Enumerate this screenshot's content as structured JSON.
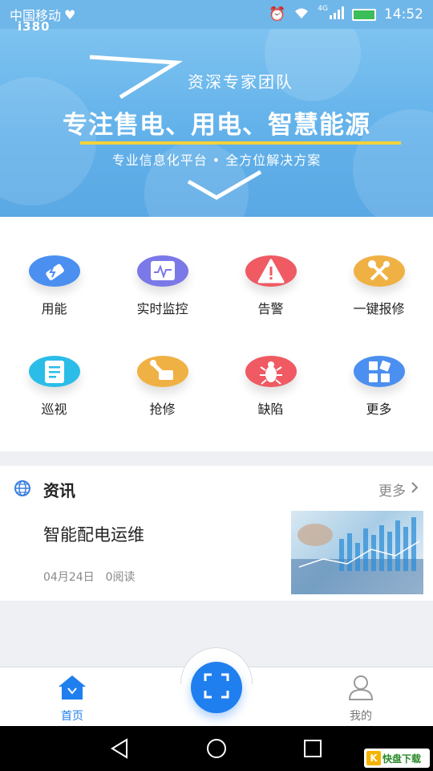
{
  "status_bar": {
    "carrier": "中国移动",
    "time": "14:52",
    "network": "4G",
    "logo": "i380"
  },
  "banner": {
    "subtitle1": "资深专家团队",
    "title": "专注售电、用电、智慧能源",
    "subtitle2": "专业信息化平台  •  全方位解决方案"
  },
  "grid": [
    {
      "label": "用能",
      "icon": "energy-icon",
      "color": "#4b8ff0"
    },
    {
      "label": "实时监控",
      "icon": "monitor-icon",
      "color": "#7b78e8"
    },
    {
      "label": "告警",
      "icon": "alert-icon",
      "color": "#ef5a63"
    },
    {
      "label": "一键报修",
      "icon": "repair-tools-icon",
      "color": "#f0b144"
    },
    {
      "label": "巡视",
      "icon": "inspection-icon",
      "color": "#2bbde8"
    },
    {
      "label": "抢修",
      "icon": "emergency-repair-icon",
      "color": "#f0b144"
    },
    {
      "label": "缺陷",
      "icon": "bug-icon",
      "color": "#ef5a63"
    },
    {
      "label": "更多",
      "icon": "more-apps-icon",
      "color": "#4b8ff0"
    }
  ],
  "news": {
    "section_title": "资讯",
    "more_label": "更多",
    "article": {
      "title": "智能配电运维",
      "date": "04月24日",
      "reads": "0阅读"
    }
  },
  "tabs": {
    "home": "首页",
    "mine": "我的"
  },
  "colors": {
    "accent": "#1f7fef",
    "banner": "#62b1ea",
    "highlight": "#f4d23b"
  },
  "watermark": {
    "text": "快盘下载"
  }
}
